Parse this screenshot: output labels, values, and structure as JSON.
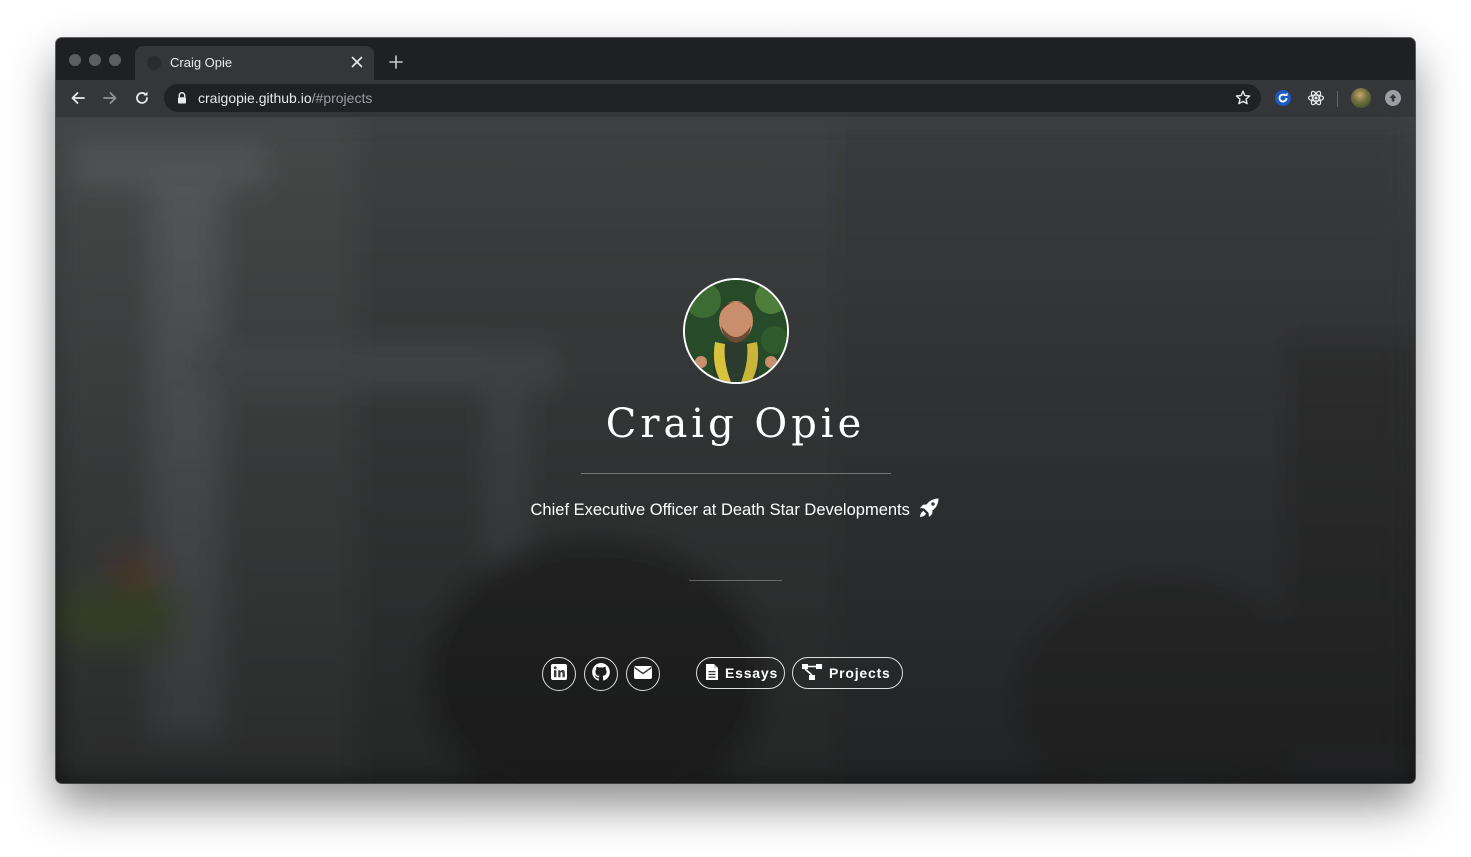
{
  "browser": {
    "tab_title": "Craig Opie",
    "url_host": "craigopie.github.io",
    "url_path": "/#projects"
  },
  "profile": {
    "name": "Craig Opie",
    "tagline": "Chief Executive Officer at Death Star Developments"
  },
  "actions": {
    "essays_label": "Essays",
    "projects_label": "Projects"
  },
  "icons": {
    "social": [
      "linkedin-icon",
      "github-icon",
      "envelope-icon"
    ],
    "tagline": "rocket-icon",
    "essays": "file-text-icon",
    "projects": "sitemap-icon"
  },
  "colors": {
    "frame": "#1f2023",
    "toolbar": "#35363a",
    "omnibox": "#202124",
    "page_text": "#ffffff"
  }
}
